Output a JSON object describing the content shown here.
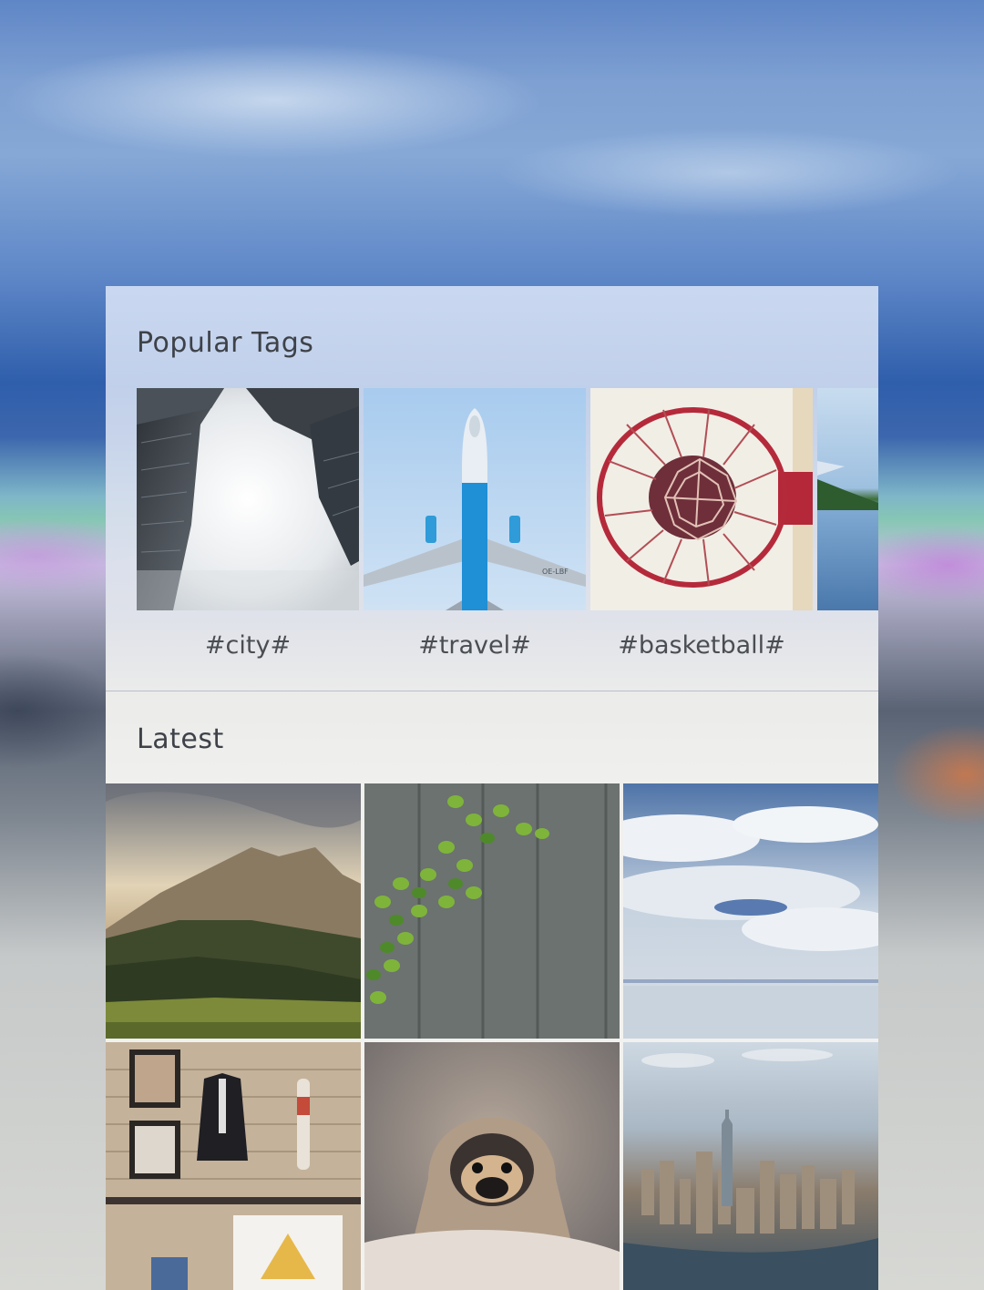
{
  "sections": {
    "popular": {
      "title": "Popular Tags",
      "tags": [
        {
          "label": "#city#",
          "image": "skyscrapers-in-fog-photo"
        },
        {
          "label": "#travel#",
          "image": "airplane-from-below-photo"
        },
        {
          "label": "#basketball#",
          "image": "basketball-hoop-photo"
        },
        {
          "label": "",
          "image": "lake-landscape-photo"
        }
      ]
    },
    "latest": {
      "title": "Latest",
      "photos": [
        {
          "image": "mountain-landscape-photo"
        },
        {
          "image": "ivy-on-wood-photo"
        },
        {
          "image": "clouds-sky-photo"
        },
        {
          "image": "clothing-store-interior-photo"
        },
        {
          "image": "pug-in-blanket-photo"
        },
        {
          "image": "city-aerial-view-photo"
        }
      ]
    }
  },
  "colors": {
    "title_text": "#3e4248",
    "tag_text": "#4a4d52",
    "divider": "#b9bfc9",
    "panel_bg": "#eeeff0"
  }
}
